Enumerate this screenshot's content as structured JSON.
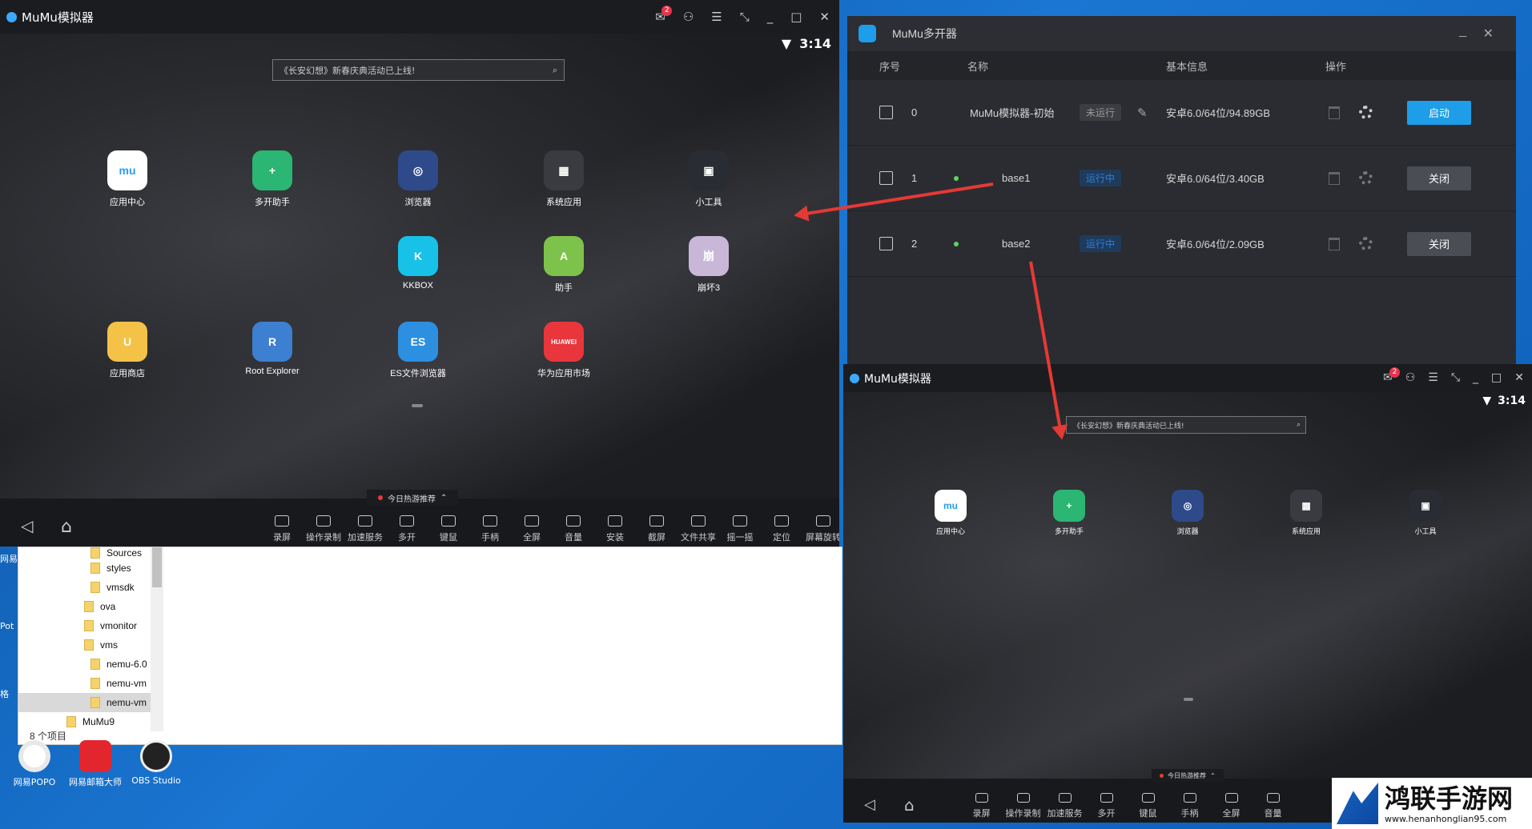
{
  "desktop": {
    "icons": [
      {
        "label": "网易POPO"
      },
      {
        "label": "网易邮箱大师"
      },
      {
        "label": "OBS Studio"
      }
    ],
    "left_labels": [
      "网易",
      "Pot",
      "格"
    ]
  },
  "explorer": {
    "tree": [
      "Sources",
      "styles",
      "vmsdk",
      "ova",
      "vmonitor",
      "vms",
      "nemu-6.0",
      "nemu-vm",
      "nemu-vm",
      "MuMu9"
    ],
    "status": "8 个项目"
  },
  "main_emulator": {
    "title": "MuMu模拟器",
    "notif_count": "2",
    "time": "3:14",
    "search_placeholder": "《长安幻想》新春庆典活动已上线!",
    "apps": [
      {
        "label": "应用中心",
        "icon": "app-center-icon",
        "color": "#ffffff",
        "glyph": "mu"
      },
      {
        "label": "多开助手",
        "icon": "multi-open-icon",
        "color": "#2bb673",
        "glyph": "+"
      },
      {
        "label": "浏览器",
        "icon": "browser-icon",
        "color": "#2e4a8a",
        "glyph": "◎"
      },
      {
        "label": "系统应用",
        "icon": "system-apps-icon",
        "color": "#3a3b40",
        "glyph": "▦"
      },
      {
        "label": "小工具",
        "icon": "tools-icon",
        "color": "#2a2c33",
        "glyph": "▣"
      },
      {
        "label": "KKBOX",
        "icon": "kkbox-icon",
        "color": "#18c1e8",
        "glyph": "K"
      },
      {
        "label": "助手",
        "icon": "android-icon",
        "color": "#7dc24a",
        "glyph": "A"
      },
      {
        "label": "崩坏3",
        "icon": "honkai-icon",
        "color": "#c9b7d8",
        "glyph": "崩"
      },
      {
        "label": "应用商店",
        "icon": "app-store-icon",
        "color": "#f3c247",
        "glyph": "U"
      },
      {
        "label": "Root Explorer",
        "icon": "root-explorer-icon",
        "color": "#3d7fd1",
        "glyph": "R"
      },
      {
        "label": "ES文件浏览器",
        "icon": "es-file-icon",
        "color": "#2d8fe0",
        "glyph": "ES"
      },
      {
        "label": "华为应用市场",
        "icon": "huawei-icon",
        "color": "#e8363c",
        "glyph": "HUAWEI"
      }
    ],
    "pill": "今日热游推荐",
    "toolbar": [
      "录屏",
      "操作录制",
      "加速服务",
      "多开",
      "键鼠",
      "手柄",
      "全屏",
      "音量",
      "安装",
      "截屏",
      "文件共享",
      "摇一摇",
      "定位",
      "屏幕旋转"
    ]
  },
  "manager": {
    "title": "MuMu多开器",
    "headers": {
      "index": "序号",
      "name": "名称",
      "info": "基本信息",
      "action": "操作"
    },
    "rows": [
      {
        "index": "0",
        "name": "MuMu模拟器-初始",
        "status": "未运行",
        "info": "安卓6.0/64位/94.89GB",
        "action": "启动",
        "running": false
      },
      {
        "index": "1",
        "name": "base1",
        "status": "运行中",
        "info": "安卓6.0/64位/3.40GB",
        "action": "关闭",
        "running": true
      },
      {
        "index": "2",
        "name": "base2",
        "status": "运行中",
        "info": "安卓6.0/64位/2.09GB",
        "action": "关闭",
        "running": true
      }
    ],
    "colors": {
      "start": "#1e9de8",
      "close": "#4a4d53",
      "running": "#2f7fd6",
      "stopped": "#6b6e75"
    }
  },
  "second_emulator": {
    "title": "MuMu模拟器",
    "notif_count": "2",
    "time": "3:14",
    "search_placeholder": "《长安幻想》新春庆典活动已上线!",
    "apps": [
      {
        "label": "应用中心",
        "color": "#ffffff",
        "glyph": "mu",
        "icon": "app-center-icon"
      },
      {
        "label": "多开助手",
        "color": "#2bb673",
        "glyph": "+",
        "icon": "multi-open-icon"
      },
      {
        "label": "浏览器",
        "color": "#2e4a8a",
        "glyph": "◎",
        "icon": "browser-icon"
      },
      {
        "label": "系统应用",
        "color": "#3a3b40",
        "glyph": "▦",
        "icon": "system-apps-icon"
      },
      {
        "label": "小工具",
        "color": "#2a2c33",
        "glyph": "▣",
        "icon": "tools-icon"
      }
    ],
    "pill": "今日热游推荐",
    "toolbar": [
      "录屏",
      "操作录制",
      "加速服务",
      "多开",
      "键鼠",
      "手柄",
      "全屏",
      "音量"
    ]
  },
  "watermark": {
    "title": "鸿联手游网",
    "url": "www.henanhonglian95.com"
  }
}
